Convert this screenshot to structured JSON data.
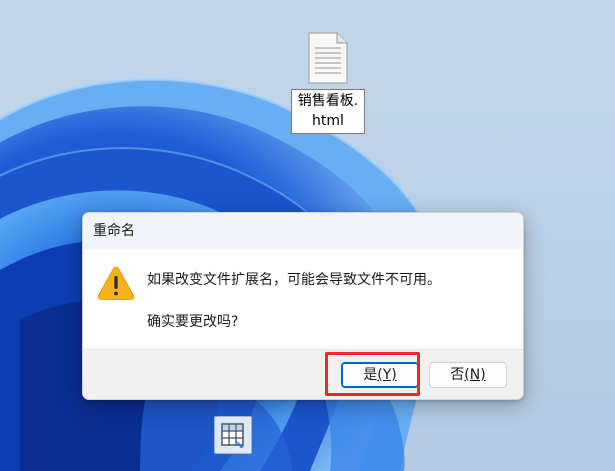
{
  "desktop": {
    "file_name": "销售看板.html",
    "file_icon": "text-document-icon",
    "bottom_icon": "spreadsheet-app-icon"
  },
  "dialog": {
    "title": "重命名",
    "icon": "warning-icon",
    "message_line1": "如果改变文件扩展名，可能会导致文件不可用。",
    "message_line2": "确实要更改吗?",
    "buttons": {
      "yes_text": "是",
      "yes_accel": "(Y)",
      "no_text": "否",
      "no_accel": "(N)"
    }
  },
  "colors": {
    "highlight": "#e8282b",
    "accent": "#0067c0",
    "warning": "#f7b21b"
  }
}
